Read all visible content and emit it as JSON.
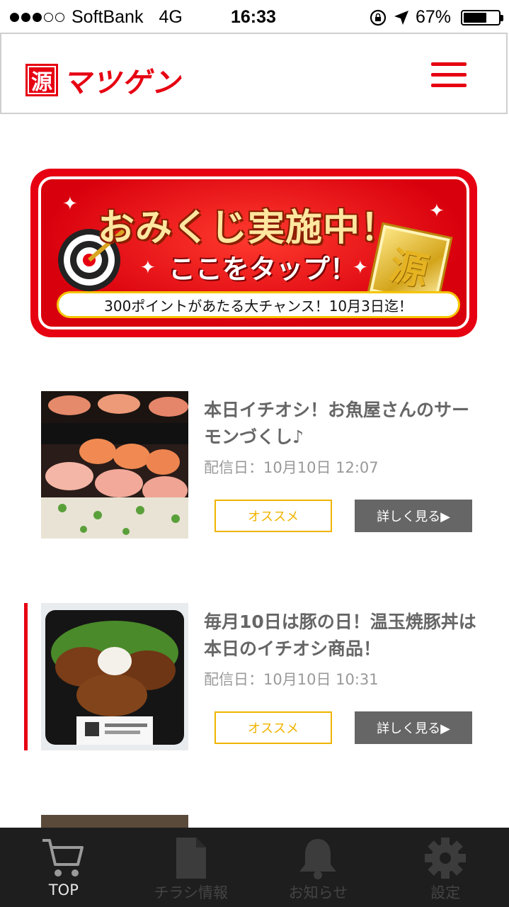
{
  "status_bar": {
    "carrier": "SoftBank",
    "network": "4G",
    "time": "16:33",
    "battery": "67%",
    "battery_level": 0.67,
    "signal_bars": 3,
    "signal_max": 5
  },
  "header": {
    "logo_mark": "源",
    "logo_text": "マツゲン",
    "menu_icon": "hamburger-menu-icon",
    "brand_color": "#e60012"
  },
  "banner": {
    "title": "おみくじ実施中！",
    "subtitle": "ここをタップ！",
    "note": "300ポイントがあたる大チャンス！10月3日迄！",
    "medal_char": "源"
  },
  "posts": [
    {
      "title": "本日イチオシ！お魚屋さんのサーモンづくし♪",
      "date": "配信日：10月10日 12:07",
      "tag": "オススメ",
      "detail": "詳しく見る▶"
    },
    {
      "title": "毎月10日は豚の日！温玉焼豚丼は本日のイチオシ商品！",
      "date": "配信日：10月10日 10:31",
      "tag": "オススメ",
      "detail": "詳しく見る▶"
    }
  ],
  "tabs": [
    {
      "label": "TOP",
      "icon": "cart-icon",
      "active": true
    },
    {
      "label": "チラシ情報",
      "icon": "document-icon",
      "active": false
    },
    {
      "label": "お知らせ",
      "icon": "bell-icon",
      "active": false
    },
    {
      "label": "設定",
      "icon": "gear-icon",
      "active": false
    }
  ]
}
